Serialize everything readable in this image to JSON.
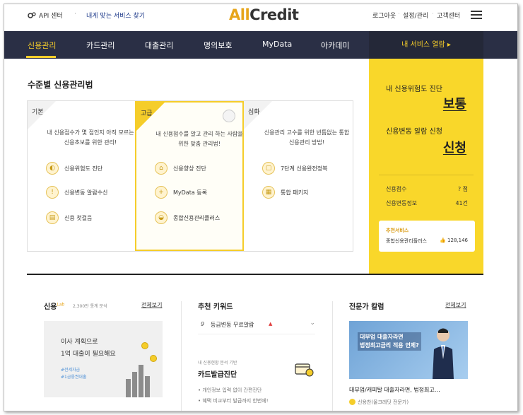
{
  "header": {
    "api_center": "API 센터",
    "dot": "·",
    "find_service": "내게 맞는 서비스 찾기",
    "logo_a": "All",
    "logo_b": "Credit",
    "logout": "로그아웃",
    "settings": "설정/관리",
    "support": "고객센터"
  },
  "nav": {
    "items": [
      "신용관리",
      "카드관리",
      "대출관리",
      "명의보호",
      "MyData",
      "아카데미"
    ],
    "my_service": "내 서비스 열람 ▸"
  },
  "section_title": "수준별 신용관리법",
  "cards": [
    {
      "level": "기본",
      "desc": "내 신용점수가 몇 점인지 아직 모르는 신용초보를 위한 관리!",
      "items": [
        {
          "label": "신용위험도 진단",
          "icon": "gauge-icon"
        },
        {
          "label": "신용변동 알람수신",
          "icon": "alarm-doc-icon"
        },
        {
          "label": "신용 첫걸음",
          "icon": "chart-doc-icon"
        }
      ]
    },
    {
      "level": "고급",
      "desc": "내 신용점수를 알고 관리 하는 사람을 위한 맞춤 관리법!",
      "items": [
        {
          "label": "신용향상 진단",
          "icon": "house-chart-icon"
        },
        {
          "label": "MyData 등록",
          "icon": "doc-plus-icon"
        },
        {
          "label": "종합신용관리플러스",
          "icon": "car-icon"
        }
      ]
    },
    {
      "level": "심화",
      "desc": "신용관리 고수를 위한 빈틈없는 통합 신용관리 방법!",
      "items": [
        {
          "label": "7단계 신용완전정복",
          "icon": "clipboard-icon"
        },
        {
          "label": "통합 패키지",
          "icon": "package-icon"
        }
      ]
    }
  ],
  "side": {
    "risk_label": "내 신용위험도 진단",
    "risk_value": "보통",
    "alarm_label": "신용변동 알람 신청",
    "alarm_value": "신청",
    "score_label": "신용점수",
    "score_value": "? 점",
    "change_label": "신용변동정보",
    "change_value": "41건",
    "rec_title": "추천서비스",
    "rec_name": "종합신용관리플러스",
    "rec_count": "128,146"
  },
  "bottom": {
    "lab_title": "신용",
    "lab_sup": "Lab",
    "lab_sub": "2,300만 통계 분석",
    "view_all": "전체보기",
    "promo_line1": "이사 계획으로",
    "promo_line2": "1억 대출이 필요해요",
    "promo_tag1": "#전세자금",
    "promo_tag2": "#1금융권대출",
    "kw_title": "추천 키워드",
    "kw_num": "9",
    "kw_text": "등급변동 무료알람",
    "kw_up": "▲",
    "svc_sub": "내 신용현황 분석 기반",
    "svc_name": "카드발급진단",
    "bul1": "• 개인정보 입력 없이 간편진단",
    "bul2": "• 혜택 비교부터 발급까지 한번에!",
    "col_title": "전문가 칼럼",
    "thumb_h1": "대부업 대출자라면",
    "thumb_h2": "법정최고금리 적용 언제?",
    "art_title": "대부업/캐피탈 대출자라면, 법정최고…",
    "art_by": "신용찬(올크레딧 전문가)"
  },
  "colors": {
    "navy": "#2a2f45",
    "yellow": "#f9d72a",
    "accent": "#f5cd2a"
  }
}
